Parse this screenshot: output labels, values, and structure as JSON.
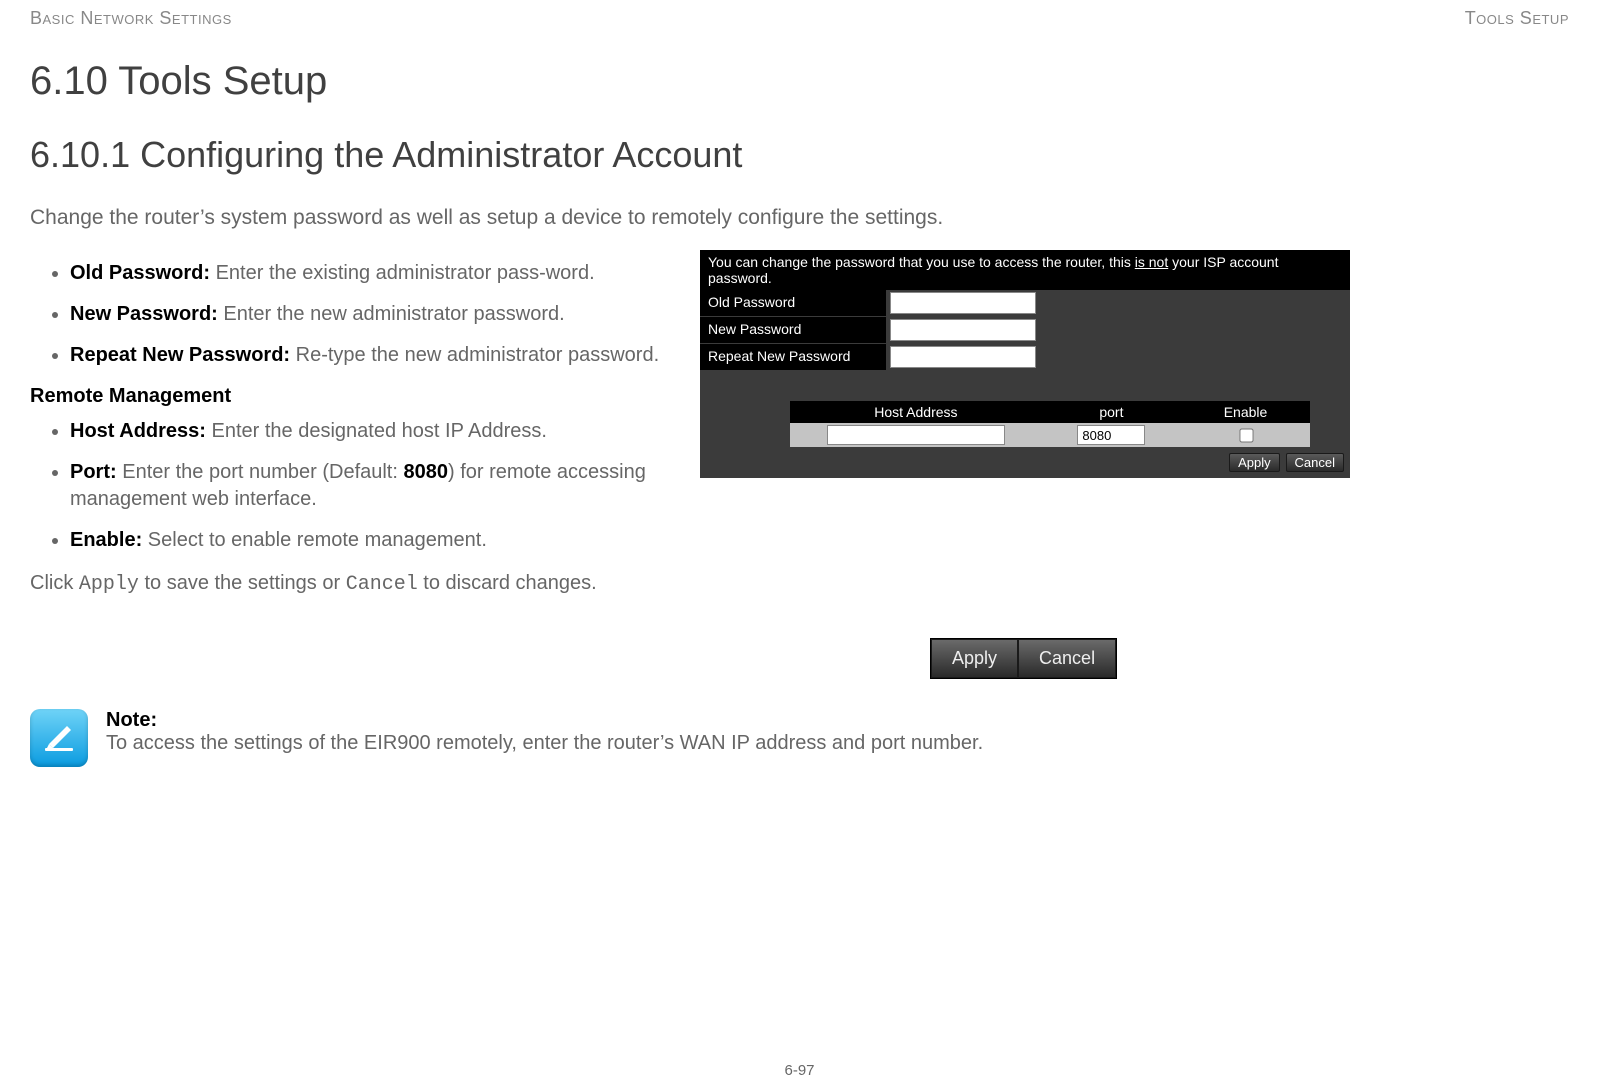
{
  "header": {
    "left": "Basic Network Settings",
    "right": "Tools Setup"
  },
  "section": {
    "title": "6.10 Tools Setup",
    "subsection_title": "6.10.1 Configuring the Administrator Account",
    "intro": "Change the router’s system password as well as setup a device to remotely configure the settings."
  },
  "bullets_top": [
    {
      "term": "Old Password:",
      "desc": "  Enter the existing administrator pass-word."
    },
    {
      "term": "New Password:",
      "desc": " Enter the new administrator password."
    },
    {
      "term": "Repeat New Password:",
      "desc": " Re-type the new administrator password."
    }
  ],
  "remote_heading": "Remote Management",
  "bullets_bottom": [
    {
      "term": "Host Address:",
      "desc": " Enter the designated host IP Address."
    },
    {
      "term": "Port:",
      "desc_pre": " Enter the port number (Default: ",
      "desc_bold": "8080",
      "desc_post": ") for remote accessing management web interface."
    },
    {
      "term": "Enable:",
      "desc": " Select to enable remote management."
    }
  ],
  "apply_cancel_sentence": {
    "pre": "Click ",
    "code1": "Apply",
    "mid": " to save the settings or ",
    "code2": "Cancel",
    "post": " to discard changes."
  },
  "router_ui": {
    "hint_pre": "You can change the password that you use to access the router, this ",
    "hint_underline": "is not",
    "hint_post": " your ISP account password.",
    "fields": {
      "old_password_label": "Old Password",
      "new_password_label": "New Password",
      "repeat_password_label": "Repeat New Password"
    },
    "table": {
      "headers": {
        "host": "Host Address",
        "port": "port",
        "enable": "Enable"
      },
      "row": {
        "host": "",
        "port": "8080",
        "enable": false
      }
    },
    "actions": {
      "apply": "Apply",
      "cancel": "Cancel"
    }
  },
  "note": {
    "label": "Note:",
    "text": "To access the settings of the EIR900 remotely, enter the router’s WAN IP address and port number."
  },
  "page_number": "6-97"
}
